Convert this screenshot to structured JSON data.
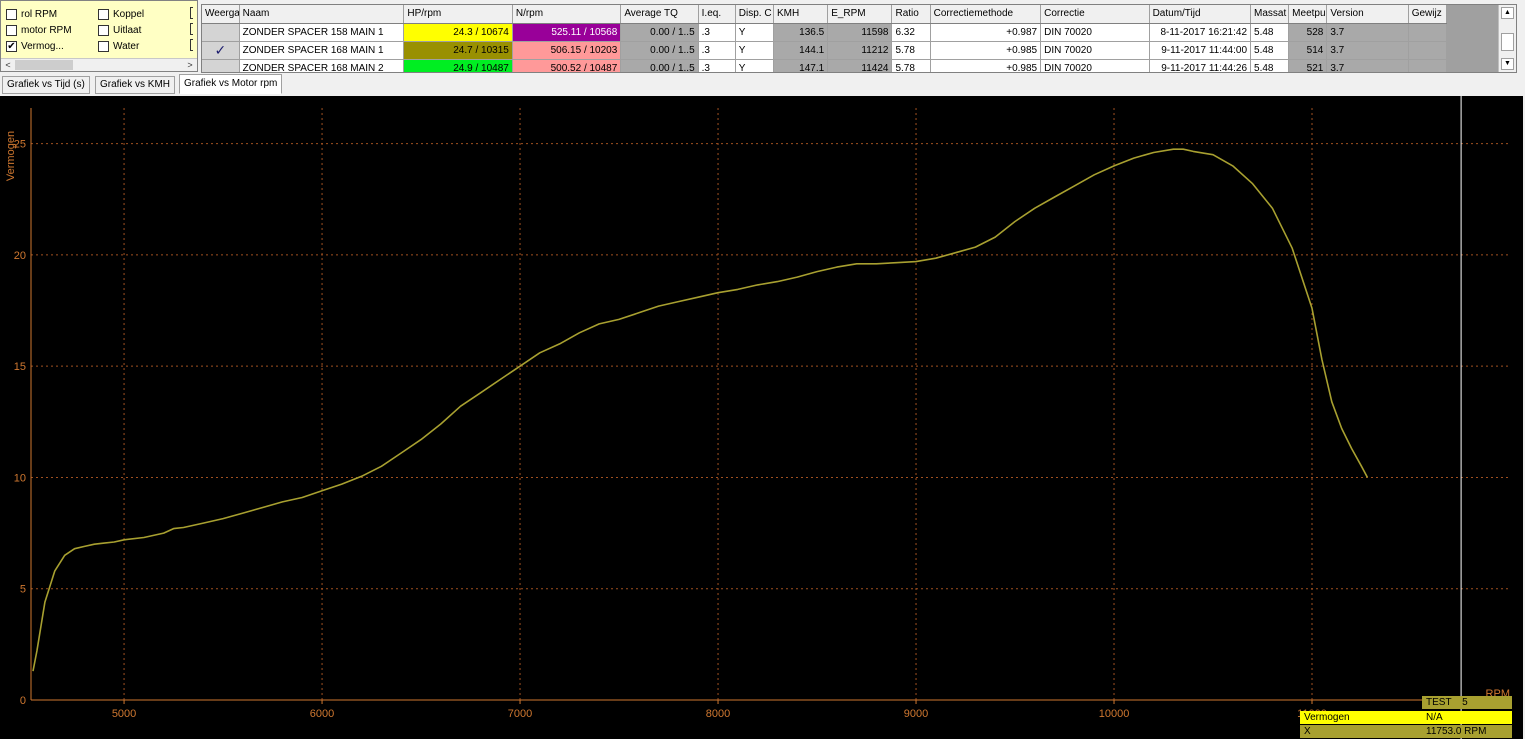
{
  "options_panel": {
    "items": [
      {
        "label": "rol RPM",
        "checked": false
      },
      {
        "label": "Koppel",
        "checked": false
      },
      {
        "label": "motor RPM",
        "checked": false
      },
      {
        "label": "Uitlaat",
        "checked": false
      },
      {
        "label": "Vermog...",
        "checked": true
      },
      {
        "label": "Water",
        "checked": false
      }
    ],
    "check_glyph": "✔",
    "scroll_left": "<",
    "scroll_right": ">"
  },
  "runs_table": {
    "columns": [
      "Weerga",
      "Naam",
      "HP/rpm",
      "N/rpm",
      "Average TQ",
      "I.eq.",
      "Disp. C",
      "KMH",
      "E_RPM",
      "Ratio",
      "Correctiemethode",
      "Correctie",
      "Datum/Tijd",
      "Massat",
      "Meetpu",
      "Version",
      "Gewijz"
    ],
    "check_glyph": "✓",
    "rows": [
      {
        "shown": false,
        "naam": "ZONDER SPACER 158 MAIN 1",
        "hp": "24.3 / 10674",
        "hp_color": "#ffff00",
        "n": "525.11 / 10568",
        "n_color": "#990099",
        "n_text_color": "#ffffff",
        "avg_tq": "0.00 / 1..5",
        "ieq": ".3",
        "disp": "Y",
        "kmh": "136.5",
        "erpm": "11598",
        "ratio": "6.32",
        "corr_method": "+0.987",
        "corr": "DIN 70020",
        "datetime": "8-11-2017 16:21:42",
        "massa": "5.48",
        "meetpunten": "528",
        "version": "3.7",
        "gewijzigd": ""
      },
      {
        "shown": true,
        "naam": "ZONDER SPACER 168 MAIN 1",
        "hp": "24.7 / 10315",
        "hp_color": "#999000",
        "n": "506.15 / 10203",
        "n_color": "#ff9999",
        "n_text_color": "#000000",
        "avg_tq": "0.00 / 1..5",
        "ieq": ".3",
        "disp": "Y",
        "kmh": "144.1",
        "erpm": "11212",
        "ratio": "5.78",
        "corr_method": "+0.985",
        "corr": "DIN 70020",
        "datetime": "9-11-2017 11:44:00",
        "massa": "5.48",
        "meetpunten": "514",
        "version": "3.7",
        "gewijzigd": ""
      },
      {
        "shown": false,
        "naam": "ZONDER SPACER 168 MAIN 2",
        "hp": "24.9 / 10487",
        "hp_color": "#00ee22",
        "n": "500.52 / 10487",
        "n_color": "#ff9999",
        "n_text_color": "#000000",
        "avg_tq": "0.00 / 1..5",
        "ieq": ".3",
        "disp": "Y",
        "kmh": "147.1",
        "erpm": "11424",
        "ratio": "5.78",
        "corr_method": "+0.985",
        "corr": "DIN 70020",
        "datetime": "9-11-2017 11:44:26",
        "massa": "5.48",
        "meetpunten": "521",
        "version": "3.7",
        "gewijzigd": ""
      }
    ]
  },
  "tabs": [
    {
      "label": "Grafiek vs Tijd (s)",
      "active": false
    },
    {
      "label": "Grafiek vs KMH",
      "active": false
    },
    {
      "label": "Grafiek vs Motor rpm",
      "active": true
    }
  ],
  "chart_data": {
    "type": "line",
    "ylabel": "Vermogen",
    "xlabel": "RPM",
    "xlim": [
      4530,
      12000
    ],
    "ylim": [
      0,
      26.6
    ],
    "xticks": [
      5000,
      6000,
      7000,
      8000,
      9000,
      10000,
      11000
    ],
    "xtick_labels": [
      "5000",
      "6000",
      "7000",
      "8000",
      "9000",
      "10000",
      "11000"
    ],
    "yticks": [
      0,
      5,
      10,
      15,
      20,
      25
    ],
    "ytick_labels": [
      "0",
      "5",
      "10",
      "15",
      "20",
      "25"
    ],
    "grid": true,
    "cursor_x": 11753,
    "colors": {
      "background": "#000000",
      "grid": "#a05020",
      "axis": "#d07830",
      "tick_text": "#d07830",
      "series": "#a8a030",
      "cursor": "#ffffff"
    },
    "series": [
      {
        "color": "#a8a030",
        "x": [
          4540,
          4560,
          4600,
          4650,
          4700,
          4750,
          4800,
          4850,
          4900,
          4950,
          5000,
          5100,
          5200,
          5250,
          5300,
          5400,
          5500,
          5600,
          5700,
          5800,
          5900,
          6000,
          6100,
          6200,
          6300,
          6400,
          6500,
          6600,
          6700,
          6800,
          6900,
          7000,
          7100,
          7200,
          7300,
          7400,
          7500,
          7600,
          7700,
          7800,
          7900,
          8000,
          8100,
          8200,
          8300,
          8400,
          8500,
          8600,
          8700,
          8800,
          8900,
          9000,
          9100,
          9200,
          9300,
          9400,
          9500,
          9600,
          9700,
          9800,
          9900,
          10000,
          10100,
          10200,
          10300,
          10350,
          10400,
          10500,
          10600,
          10700,
          10800,
          10900,
          11000,
          11050,
          11100,
          11150,
          11200,
          11250,
          11280
        ],
        "values": [
          1.3,
          2.2,
          4.4,
          5.8,
          6.5,
          6.8,
          6.9,
          7.0,
          7.05,
          7.1,
          7.2,
          7.3,
          7.5,
          7.7,
          7.75,
          7.95,
          8.15,
          8.4,
          8.65,
          8.9,
          9.1,
          9.4,
          9.7,
          10.05,
          10.5,
          11.1,
          11.7,
          12.4,
          13.2,
          13.8,
          14.4,
          15.0,
          15.6,
          16.0,
          16.5,
          16.9,
          17.1,
          17.4,
          17.7,
          17.9,
          18.1,
          18.3,
          18.45,
          18.65,
          18.8,
          19.0,
          19.25,
          19.45,
          19.6,
          19.6,
          19.65,
          19.7,
          19.85,
          20.1,
          20.35,
          20.8,
          21.5,
          22.1,
          22.6,
          23.1,
          23.6,
          24.0,
          24.35,
          24.6,
          24.75,
          24.75,
          24.65,
          24.5,
          24.0,
          23.2,
          22.1,
          20.3,
          17.6,
          15.3,
          13.4,
          12.2,
          11.3,
          10.5,
          10.0
        ]
      }
    ]
  },
  "readout": {
    "test_label": "TEST",
    "test_value": "5",
    "rows": [
      {
        "label": "Vermogen",
        "value": "N/A"
      },
      {
        "label": "X",
        "value": "11753.0 RPM"
      }
    ]
  }
}
